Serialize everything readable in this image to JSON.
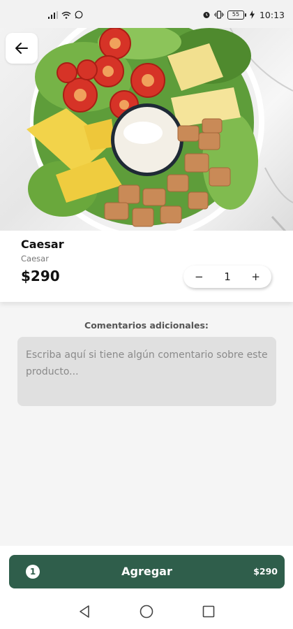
{
  "status_bar": {
    "battery": "55",
    "time": "10:13"
  },
  "product": {
    "name": "Caesar",
    "subtitle": "Caesar",
    "price": "$290",
    "quantity": "1",
    "decrement_symbol": "−",
    "increment_symbol": "+"
  },
  "comments": {
    "label": "Comentarios adicionales:",
    "placeholder": "Escriba aquí si tiene algún comentario sobre este producto..."
  },
  "add_bar": {
    "count": "1",
    "label": "Agregar",
    "total": "$290"
  },
  "colors": {
    "accent": "#2f5e4b",
    "input_bg": "#e0e0e0",
    "page_bg": "#f5f5f5"
  },
  "icons": {
    "back": "arrow-left-icon",
    "nav_back": "triangle-back-icon",
    "nav_home": "circle-home-icon",
    "nav_recents": "square-recents-icon"
  }
}
